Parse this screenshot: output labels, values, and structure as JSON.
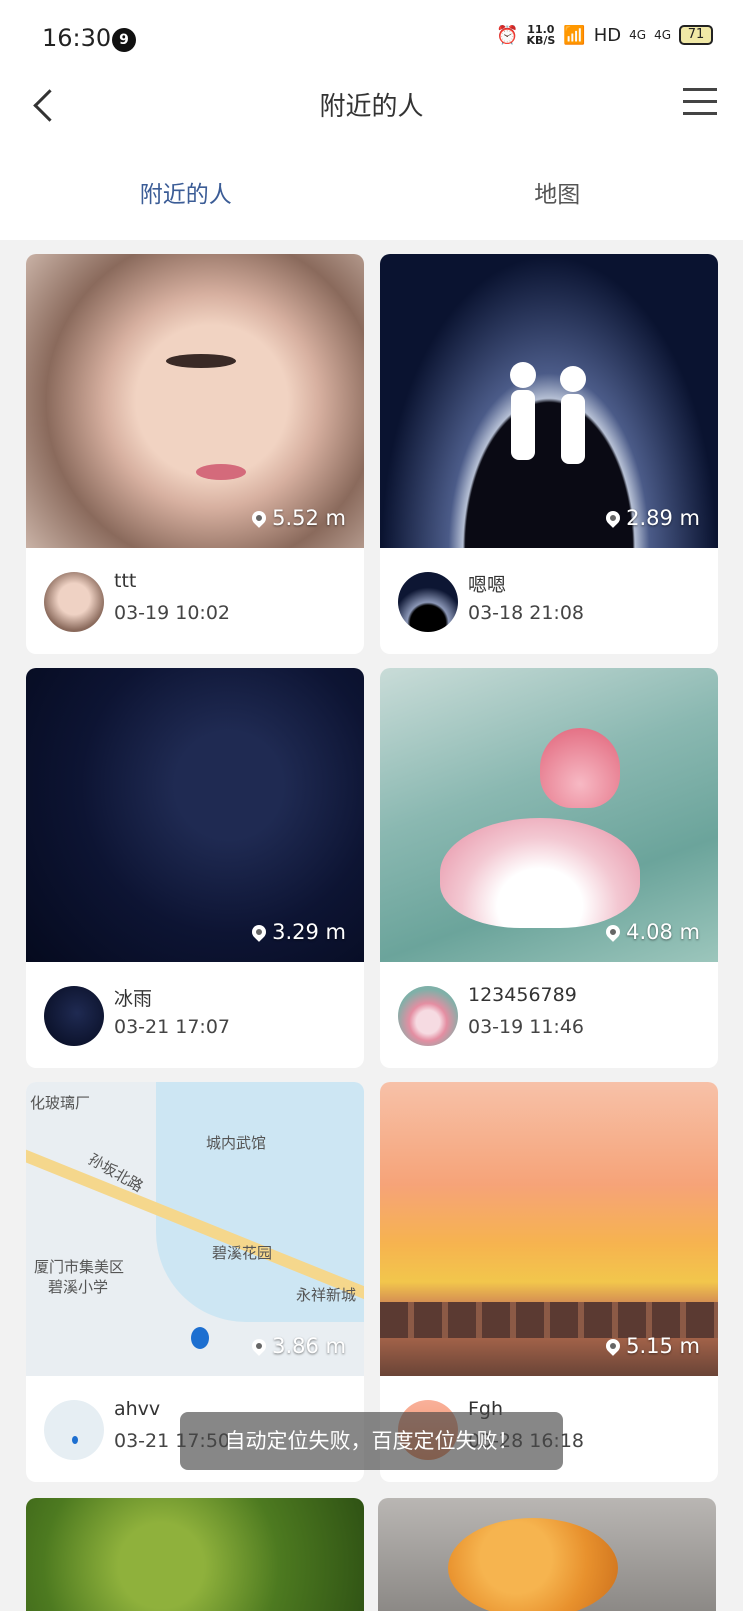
{
  "status": {
    "time": "16:30",
    "notification_count": "9",
    "net_speed_value": "11.0",
    "net_speed_unit": "KB/S",
    "hd_label": "HD",
    "sim1_label": "4G",
    "sim2_label": "4G",
    "battery": "71"
  },
  "header": {
    "title": "附近的人"
  },
  "tabs": [
    {
      "label": "附近的人",
      "active": true
    },
    {
      "label": "地图",
      "active": false
    }
  ],
  "cards": [
    {
      "name": "ttt",
      "time": "03-19 10:02",
      "distance": "5.52 m"
    },
    {
      "name": "嗯嗯",
      "time": "03-18 21:08",
      "distance": "2.89 m"
    },
    {
      "name": "冰雨",
      "time": "03-21 17:07",
      "distance": "3.29 m"
    },
    {
      "name": "123456789",
      "time": "03-19 11:46",
      "distance": "4.08 m"
    },
    {
      "name": "ahvv",
      "time": "03-21 17:50",
      "distance": "3.86 m",
      "map_labels": [
        "城内武馆",
        "碧溪花园",
        "厦门市集美区",
        "碧溪小学",
        "永祥新城",
        "孙坂北路",
        "化玻璃厂"
      ]
    },
    {
      "name": "Fgh",
      "time": "03-28 16:18",
      "distance": "5.15 m"
    }
  ],
  "toast": "自动定位失败，百度定位失败！",
  "colors": {
    "accent": "#3b5c96"
  }
}
